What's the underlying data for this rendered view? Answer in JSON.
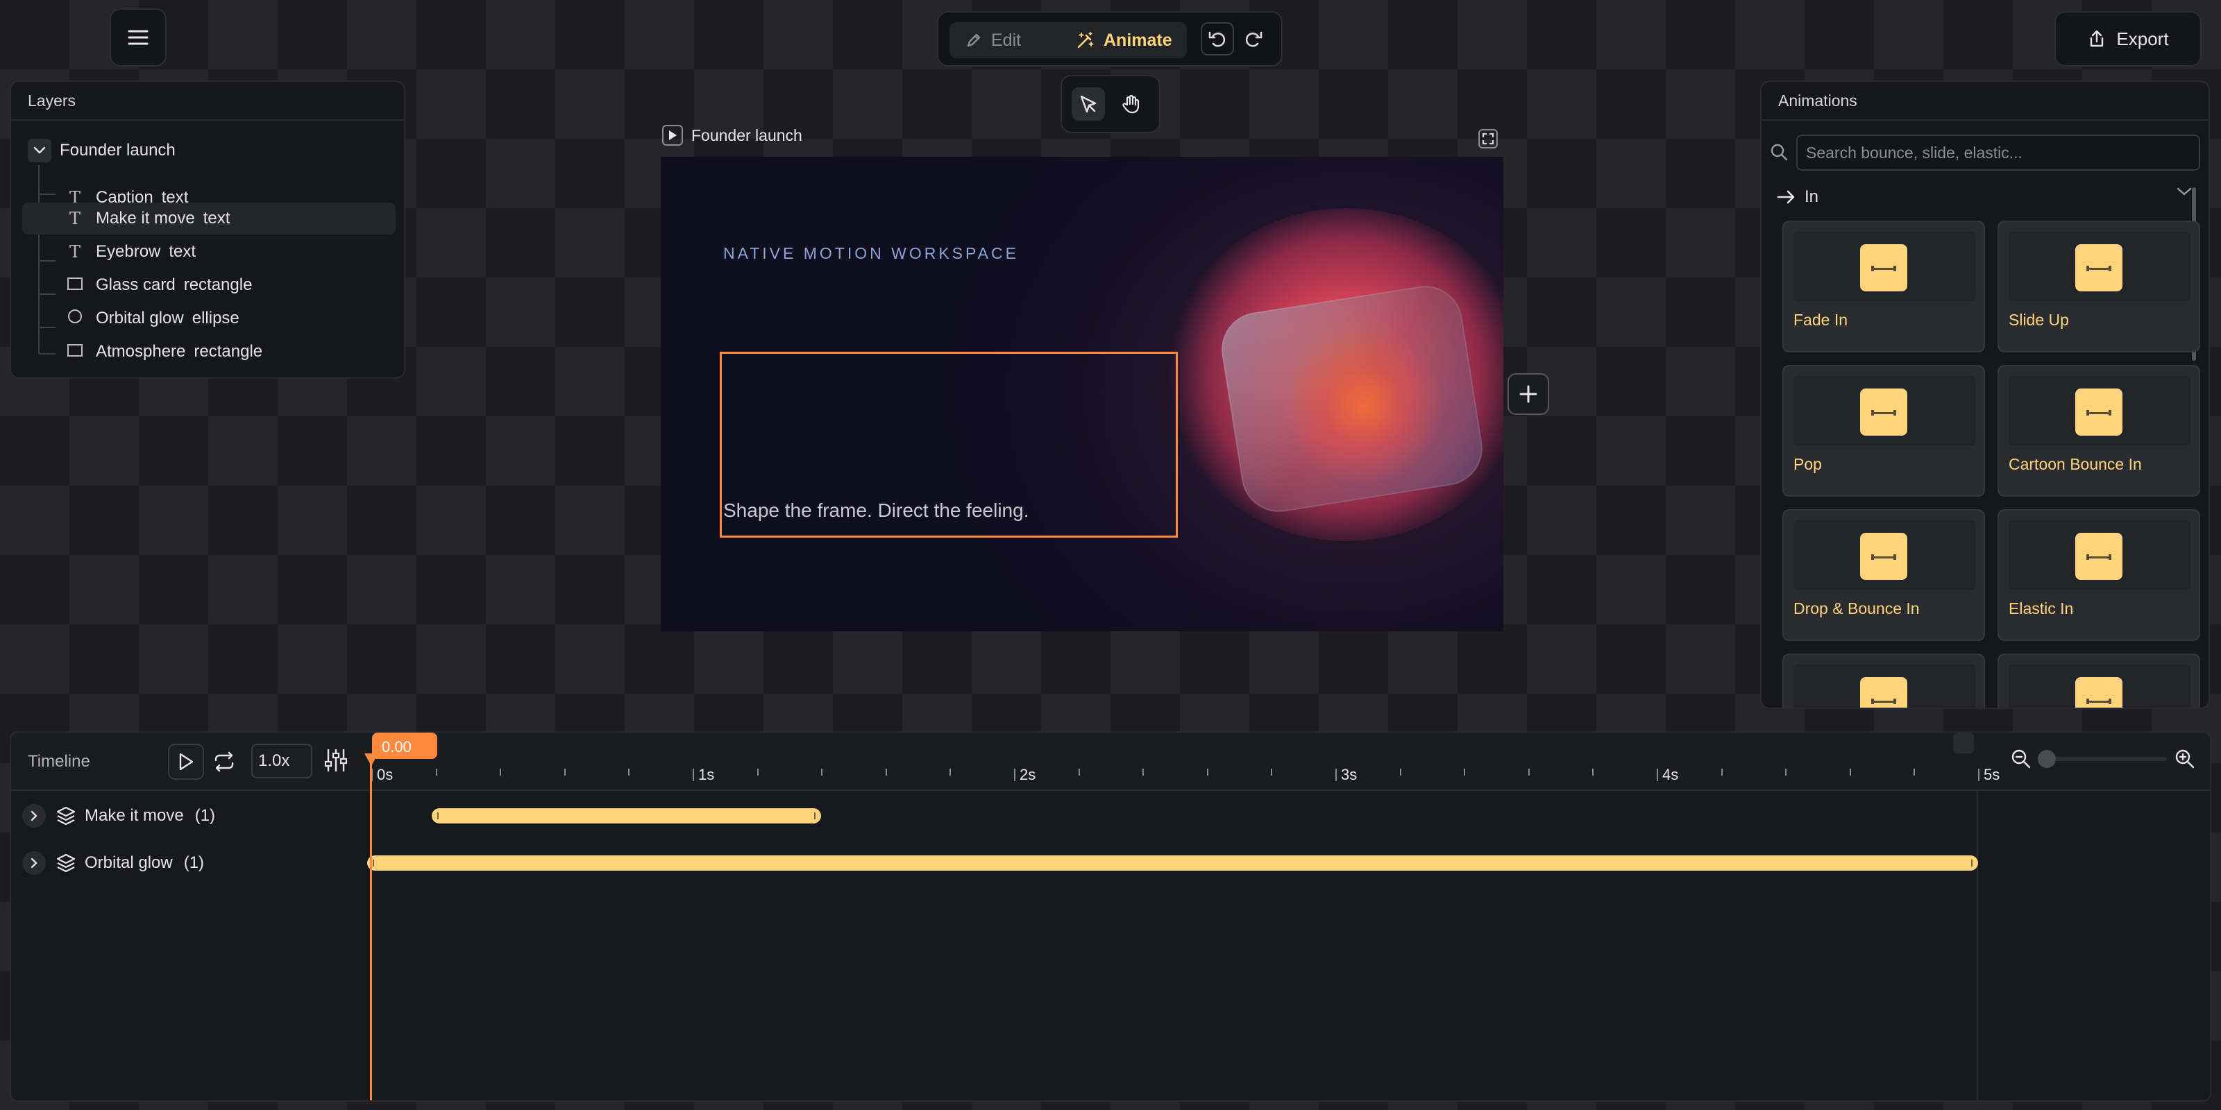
{
  "topbar": {
    "edit_label": "Edit",
    "animate_label": "Animate",
    "export_label": "Export"
  },
  "layers": {
    "title": "Layers",
    "root": "Founder launch",
    "items": [
      {
        "name": "Caption",
        "type": "text",
        "icon": "text-icon"
      },
      {
        "name": "Make it move",
        "type": "text",
        "icon": "text-icon",
        "selected": true
      },
      {
        "name": "Eyebrow",
        "type": "text",
        "icon": "text-icon"
      },
      {
        "name": "Glass card",
        "type": "rectangle",
        "icon": "rectangle-icon"
      },
      {
        "name": "Orbital glow",
        "type": "ellipse",
        "icon": "ellipse-icon"
      },
      {
        "name": "Atmosphere",
        "type": "rectangle",
        "icon": "rectangle-icon"
      }
    ]
  },
  "canvas": {
    "scene_name": "Founder launch",
    "eyebrow": "NATIVE MOTION WORKSPACE",
    "caption": "Shape the frame. Direct the feeling.",
    "selection_color": "#ff8a3d"
  },
  "animations": {
    "title": "Animations",
    "search_placeholder": "Search bounce, slide, elastic...",
    "section": "In",
    "presets": [
      "Fade In",
      "Slide Up",
      "Pop",
      "Cartoon Bounce In",
      "Drop & Bounce In",
      "Elastic In"
    ],
    "accent": "#ffd47a"
  },
  "timeline": {
    "title": "Timeline",
    "speed": "1.0x",
    "playhead": "0.00",
    "ticks": [
      "0s",
      "1s",
      "2s",
      "3s",
      "4s",
      "5s"
    ],
    "tracks": [
      {
        "name": "Make it move",
        "count": "(1)",
        "start_s": 0.2,
        "end_s": 1.4
      },
      {
        "name": "Orbital glow",
        "count": "(1)",
        "start_s": 0.0,
        "end_s": 5.0
      }
    ],
    "playhead_color": "#ff8a3d",
    "track_color": "#ffd47a"
  }
}
